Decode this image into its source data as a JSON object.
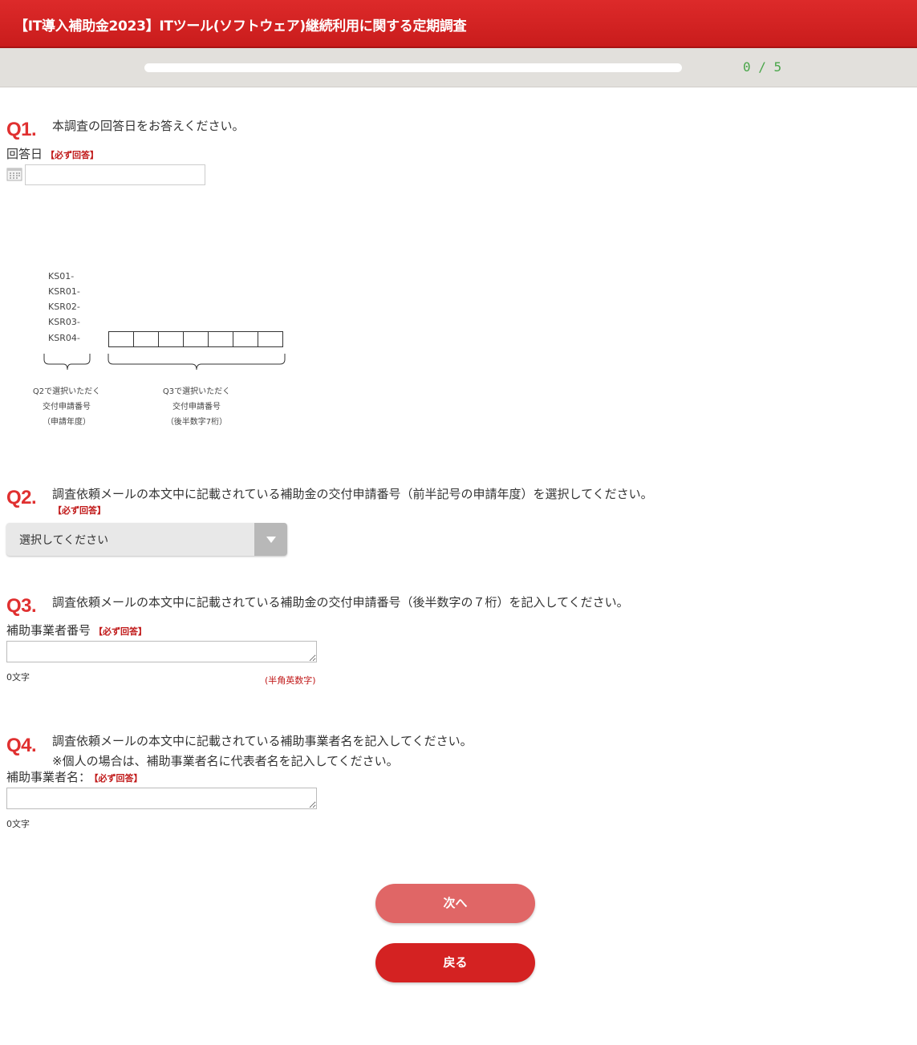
{
  "header": {
    "title": "【IT導入補助金2023】ITツール(ソフトウェア)継続利用に関する定期調査"
  },
  "progress": {
    "text": "0 / 5",
    "fraction": 0.0
  },
  "required_label": "【必ず回答】",
  "q1": {
    "number": "Q1.",
    "text": "本調査の回答日をお答えください。",
    "field_label": "回答日",
    "date_value": ""
  },
  "diagram": {
    "codes": [
      "KS01-",
      "KSR01-",
      "KSR02-",
      "KSR03-",
      "KSR04-"
    ],
    "note_left": [
      "Q2で選択いただく",
      "交付申請番号",
      "（申請年度）"
    ],
    "note_right": [
      "Q3で選択いただく",
      "交付申請番号",
      "（後半数字7桁）"
    ]
  },
  "q2": {
    "number": "Q2.",
    "text": "調査依頼メールの本文中に記載されている補助金の交付申請番号（前半記号の申請年度）を選択してください。",
    "select_value": "選択してください"
  },
  "q3": {
    "number": "Q3.",
    "text": "調査依頼メールの本文中に記載されている補助金の交付申請番号（後半数字の７桁）を記入してください。",
    "field_label": "補助事業者番号",
    "value": "",
    "count": "0文字",
    "hint": "(半角英数字)"
  },
  "q4": {
    "number": "Q4.",
    "text": "調査依頼メールの本文中に記載されている補助事業者名を記入してください。",
    "text2": "※個人の場合は、補助事業者名に代表者名を記入してください。",
    "field_label": "補助事業者名：",
    "value": "",
    "count": "0文字"
  },
  "buttons": {
    "next": "次へ",
    "back": "戻る"
  },
  "colors": {
    "brand_red": "#d42222",
    "next_button": "#e06666",
    "progress_text": "#49a649"
  }
}
